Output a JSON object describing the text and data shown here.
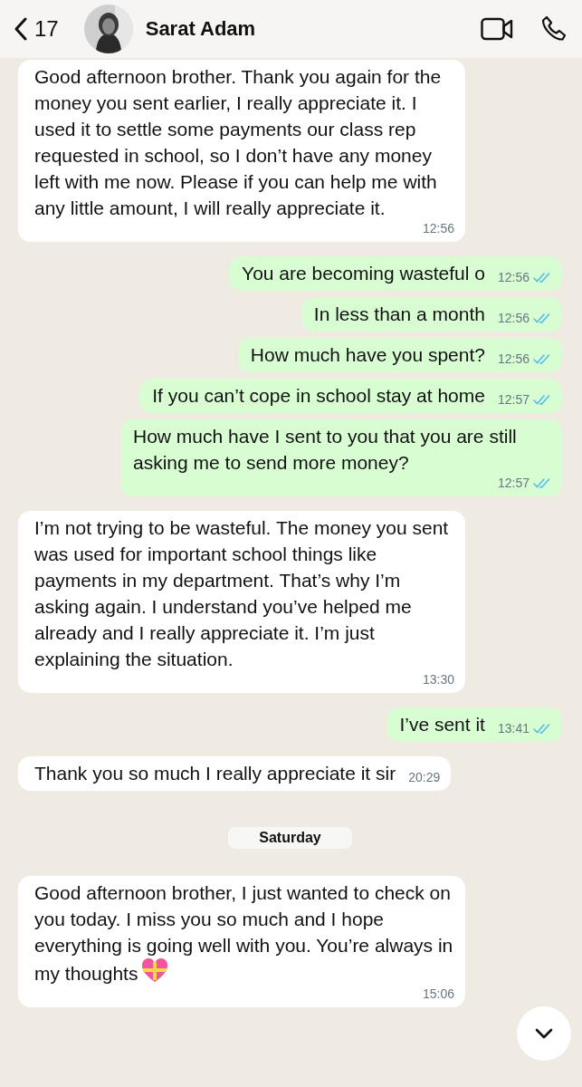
{
  "header": {
    "back_count": "17",
    "contact_name": "Sarat Adam"
  },
  "messages": [
    {
      "kind": "received",
      "text": "Good afternoon brother. Thank you again for the money you sent earlier, I really appreciate it. I used it to settle some payments our class rep requested in school, so I don’t have any money left with me now. Please if you can help me with any little amount, I will really appreciate it.",
      "time": "12:56"
    },
    {
      "kind": "sent",
      "text": "You are becoming wasteful o",
      "time": "12:56",
      "read": true
    },
    {
      "kind": "sent",
      "text": "In less than a month",
      "time": "12:56",
      "read": true
    },
    {
      "kind": "sent",
      "text": "How much have you spent?",
      "time": "12:56",
      "read": true
    },
    {
      "kind": "sent",
      "text": "If you can’t cope in school stay at home",
      "time": "12:57",
      "read": true
    },
    {
      "kind": "sent",
      "text": "How much have I sent to you that you are still asking me to send more money?",
      "time": "12:57",
      "read": true
    },
    {
      "kind": "received",
      "text": "I’m not trying to be wasteful. The money you sent was used for important school things like payments in my department. That’s why I’m asking again. I understand you’ve helped me already and I really appreciate it. I’m just explaining the situation.",
      "time": "13:30"
    },
    {
      "kind": "sent",
      "text": "I’ve sent it",
      "time": "13:41",
      "read": true
    },
    {
      "kind": "received",
      "text": "Thank you so much I really appreciate it sir",
      "time": "20:29"
    },
    {
      "kind": "date",
      "text": "Saturday"
    },
    {
      "kind": "received",
      "text": "Good afternoon brother, I just wanted to check on you today. I miss you so much and I hope everything is going well with you. You’re always in my thoughts",
      "time": "15:06",
      "heart_emoji": true
    }
  ]
}
